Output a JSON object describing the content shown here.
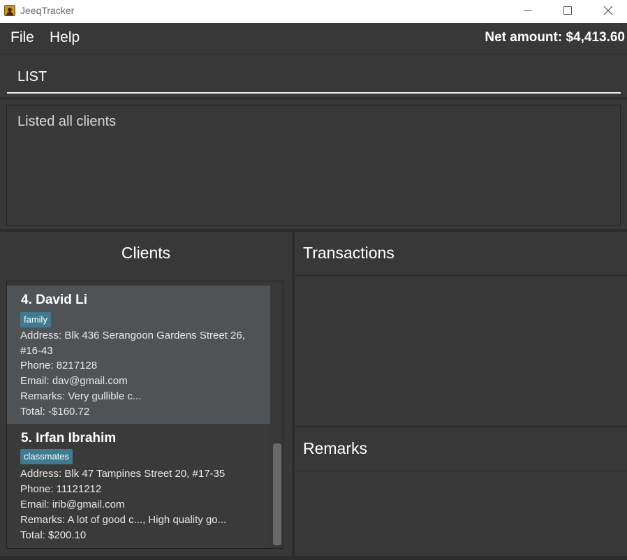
{
  "window": {
    "title": "JeeqTracker"
  },
  "menu": {
    "file": "File",
    "help": "Help"
  },
  "net_amount": "Net amount: $4,413.60",
  "command": {
    "value": "LIST"
  },
  "result": {
    "message": "Listed all clients"
  },
  "clients": {
    "title": "Clients",
    "items": [
      {
        "name": "4.  David Li",
        "tag": "family",
        "address_line1": "Address: Blk 436 Serangoon Gardens Street 26,",
        "address_line2": "#16-43",
        "phone": "Phone: 8217128",
        "email": "Email: dav@gmail.com",
        "remarks": "Remarks: Very gullible c...",
        "total": "Total: -$160.72"
      },
      {
        "name": "5.  Irfan Ibrahim",
        "tag": "classmates",
        "address_line1": "Address: Blk 47 Tampines Street 20, #17-35",
        "phone": "Phone: 11121212",
        "email": "Email: irib@gmail.com",
        "remarks": "Remarks: A lot of good c..., High quality go...",
        "total": "Total: $200.10"
      }
    ]
  },
  "transactions": {
    "title": "Transactions"
  },
  "remarks_panel": {
    "title": "Remarks"
  },
  "colors": {
    "background": "#383838",
    "selected_card": "#4f5356",
    "tag": "#3e7b91"
  }
}
